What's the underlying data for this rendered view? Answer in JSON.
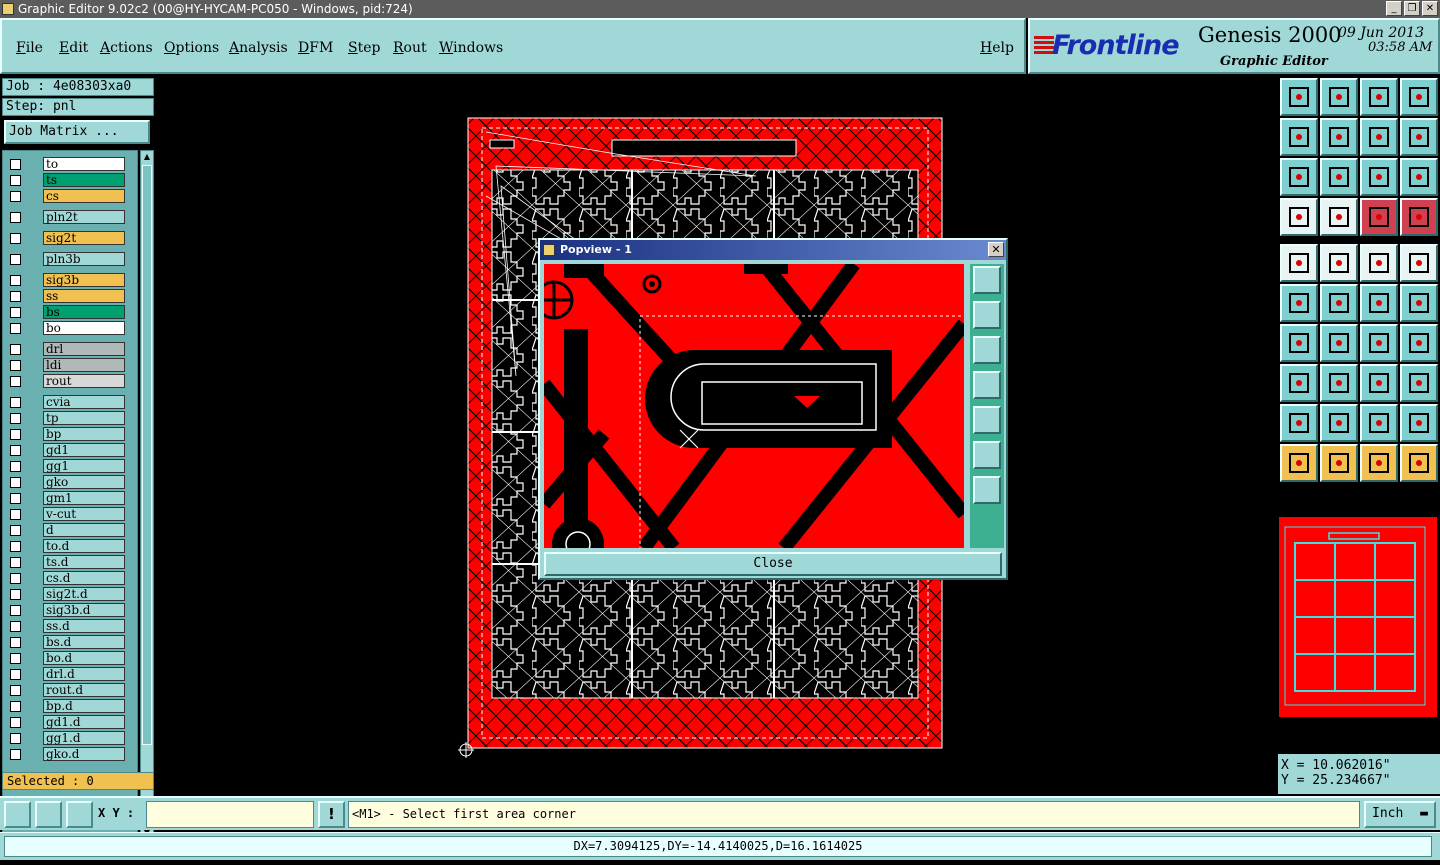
{
  "window": {
    "title": "Graphic Editor 9.02c2 (00@HY-HYCAM-PC050 - Windows, pid:724)",
    "controls": [
      "_",
      "❐",
      "✕"
    ]
  },
  "menu": {
    "items": [
      "File",
      "Edit",
      "Actions",
      "Options",
      "Analysis",
      "DFM",
      "Step",
      "Rout",
      "Windows"
    ],
    "help": "Help"
  },
  "brand": {
    "logo": "Frontline",
    "product": "Genesis 2000",
    "subtitle": "Graphic Editor",
    "date": "09 Jun 2013",
    "time": "03:58 AM"
  },
  "job": {
    "job_label": "Job : 4e08303xa0",
    "step_label": "Step: pnl",
    "matrix_button": "Job Matrix ..."
  },
  "layers": [
    {
      "name": "to",
      "color": "#ffffff"
    },
    {
      "name": "ts",
      "color": "#00a070"
    },
    {
      "name": "cs",
      "color": "#f0c050"
    },
    {
      "name": "pln2t",
      "color": "#a0d8d8"
    },
    {
      "name": "sig2t",
      "color": "#f0c050"
    },
    {
      "name": "pln3b",
      "color": "#a0d8d8"
    },
    {
      "name": "sig3b",
      "color": "#f0c050"
    },
    {
      "name": "ss",
      "color": "#f0c050"
    },
    {
      "name": "bs",
      "color": "#00a070"
    },
    {
      "name": "bo",
      "color": "#ffffff"
    },
    {
      "name": "drl",
      "color": "#b0b8b8"
    },
    {
      "name": "ldi",
      "color": "#b0b8b8"
    },
    {
      "name": "rout",
      "color": "#d8d8d8"
    },
    {
      "name": "cvia",
      "color": "#a0d8d8"
    },
    {
      "name": "tp",
      "color": "#a0d8d8"
    },
    {
      "name": "bp",
      "color": "#a0d8d8"
    },
    {
      "name": "gd1",
      "color": "#a0d8d8"
    },
    {
      "name": "gg1",
      "color": "#a0d8d8"
    },
    {
      "name": "gko",
      "color": "#a0d8d8"
    },
    {
      "name": "gm1",
      "color": "#a0d8d8"
    },
    {
      "name": "v-cut",
      "color": "#a0d8d8"
    },
    {
      "name": "d",
      "color": "#a0d8d8"
    },
    {
      "name": "to.d",
      "color": "#a0d8d8"
    },
    {
      "name": "ts.d",
      "color": "#a0d8d8"
    },
    {
      "name": "cs.d",
      "color": "#a0d8d8"
    },
    {
      "name": "sig2t.d",
      "color": "#a0d8d8"
    },
    {
      "name": "sig3b.d",
      "color": "#a0d8d8"
    },
    {
      "name": "ss.d",
      "color": "#a0d8d8"
    },
    {
      "name": "bs.d",
      "color": "#a0d8d8"
    },
    {
      "name": "bo.d",
      "color": "#a0d8d8"
    },
    {
      "name": "drl.d",
      "color": "#a0d8d8"
    },
    {
      "name": "rout.d",
      "color": "#a0d8d8"
    },
    {
      "name": "bp.d",
      "color": "#a0d8d8"
    },
    {
      "name": "gd1.d",
      "color": "#a0d8d8"
    },
    {
      "name": "gg1.d",
      "color": "#a0d8d8"
    },
    {
      "name": "gko.d",
      "color": "#a0d8d8"
    }
  ],
  "selected": "Selected : 0",
  "popup": {
    "title": "Popview - 1",
    "close_label": "Close"
  },
  "coords": {
    "x": "X = 10.062016\"",
    "y": "Y = 25.234667\""
  },
  "bottom": {
    "xy_label": "X Y :",
    "xy_value": "",
    "prompt": "<M1> - Select first area corner",
    "unit": "Inch"
  },
  "status": "DX=7.3094125,DY=-14.4140025,D=16.1614025",
  "colors": {
    "panel": "#a0d8d8",
    "board": "#ff0000",
    "active_layer": "#f0c050"
  }
}
